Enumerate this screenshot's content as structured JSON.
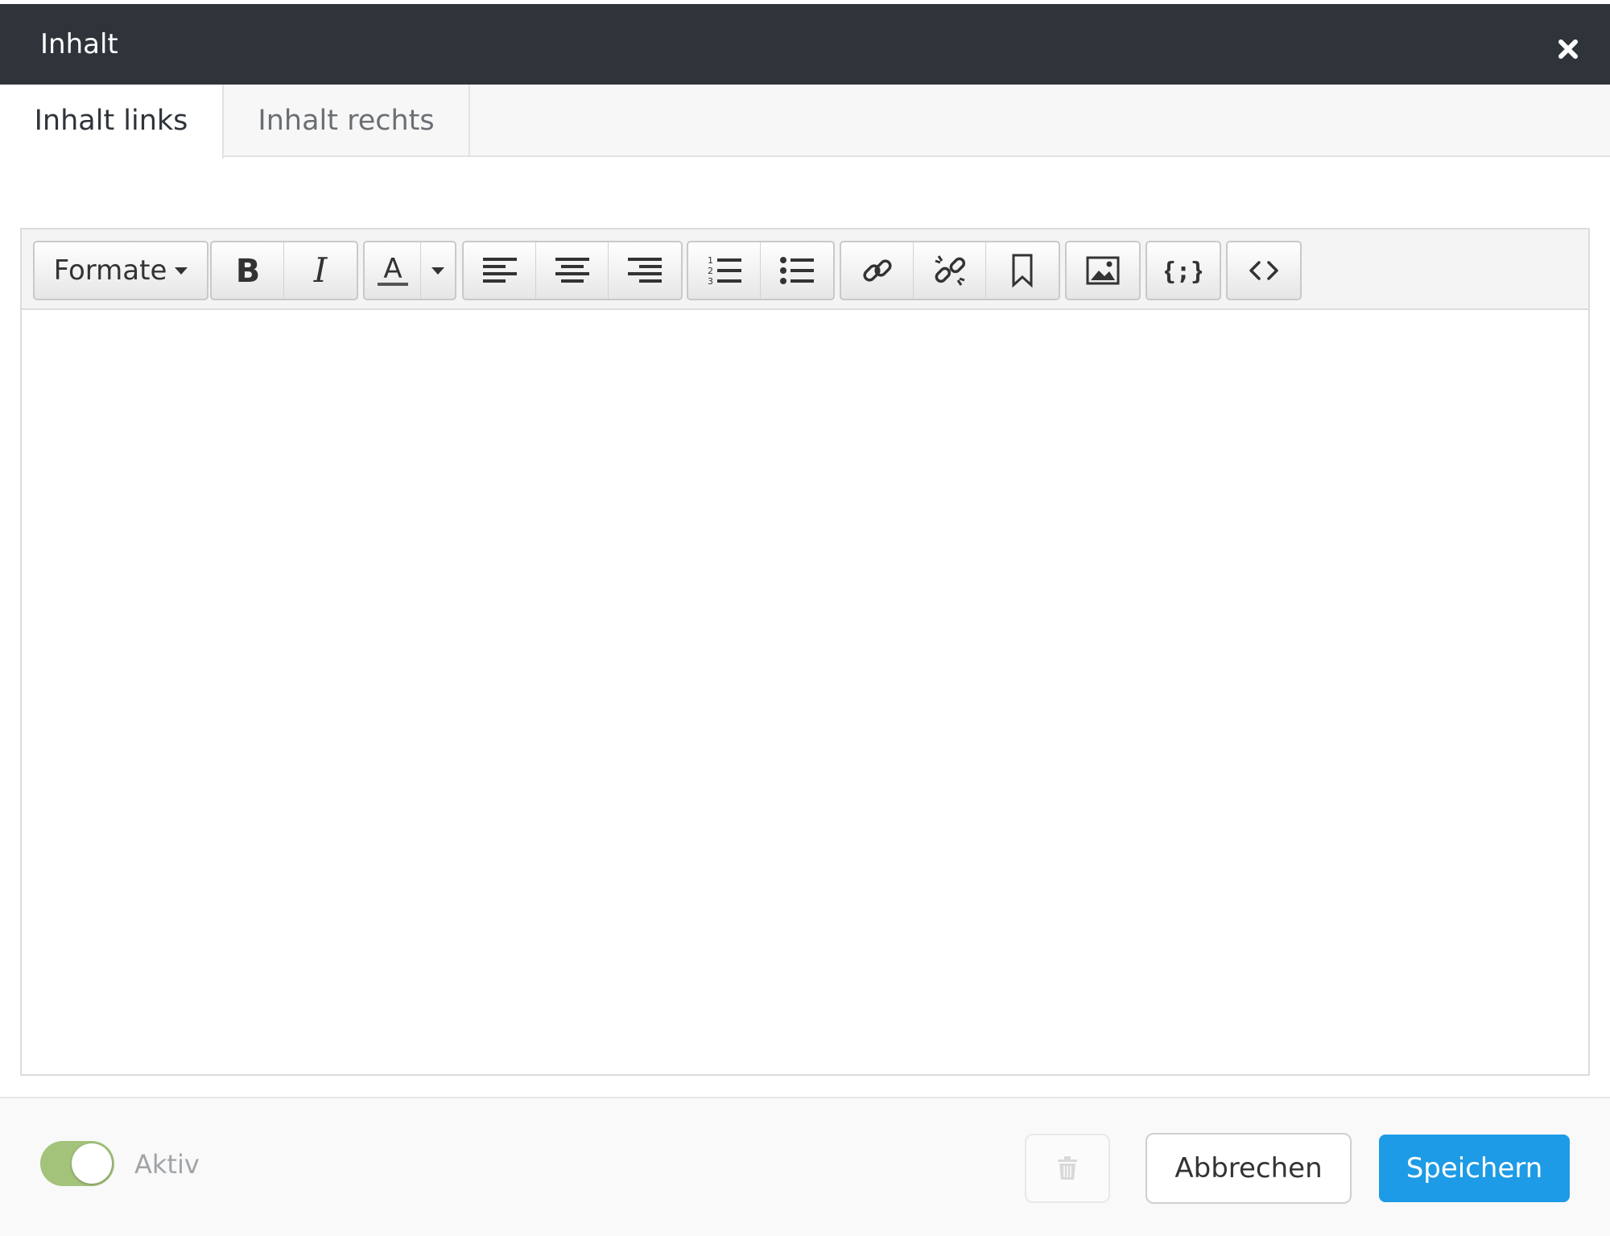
{
  "dialog": {
    "title": "Inhalt"
  },
  "tabs": [
    {
      "label": "Inhalt links",
      "active": true
    },
    {
      "label": "Inhalt rechts",
      "active": false
    }
  ],
  "toolbar": {
    "formats_label": "Formate",
    "text_color_letter": "A"
  },
  "editor": {
    "content": ""
  },
  "footer": {
    "active_label": "Aktiv",
    "active_on": true,
    "cancel_label": "Abbrechen",
    "save_label": "Speichern"
  },
  "colors": {
    "header_bg": "#2f343b",
    "accent": "#1e9be6",
    "toggle_on": "#a3c27a"
  }
}
